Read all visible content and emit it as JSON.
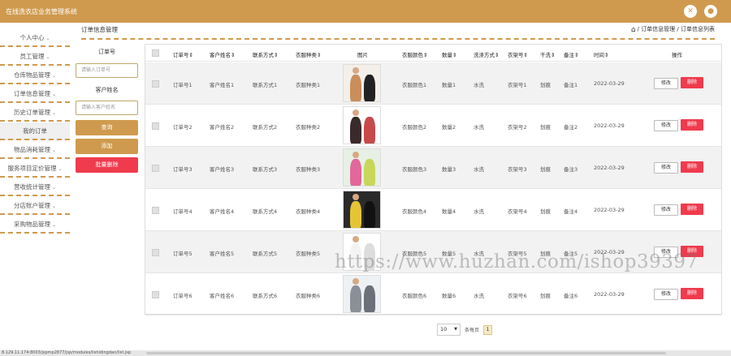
{
  "app": {
    "title": "在线洗衣店业务管理系统",
    "brand_color": "#cf9a4e"
  },
  "topbar": {
    "icons": [
      "expand-icon",
      "user-icon"
    ]
  },
  "sidebar": {
    "items": [
      {
        "label": "个人中心",
        "active": false
      },
      {
        "label": "员工管理",
        "active": false
      },
      {
        "label": "仓库物品管理",
        "active": false
      },
      {
        "label": "订单信息管理",
        "active": false
      },
      {
        "label": "历史订单管理",
        "active": false
      },
      {
        "label": "我的订单",
        "active": true
      },
      {
        "label": "物品消耗管理",
        "active": false
      },
      {
        "label": "服务项目定价管理",
        "active": false
      },
      {
        "label": "营收统计管理",
        "active": false
      },
      {
        "label": "分店账户管理",
        "active": false
      },
      {
        "label": "采购物品管理",
        "active": false
      }
    ]
  },
  "page": {
    "title": "订单信息管理",
    "breadcrumb": [
      "订单信息管理",
      "订单信息列表"
    ]
  },
  "search": {
    "order_no_label": "订单号",
    "order_no_placeholder": "请输入订单号",
    "customer_label": "客户姓名",
    "customer_placeholder": "请输入客户姓名",
    "query_button": "查询",
    "add_button": "添加",
    "batch_delete_button": "批量删除",
    "query_color": "#cf9a4e",
    "delete_color": "#ef3b4d"
  },
  "table": {
    "headers": [
      "订单号⇕",
      "客户姓名⇕",
      "联系方式⇕",
      "衣服种类⇕",
      "图片",
      "衣服颜色⇕",
      "数量⇕",
      "洗涤方式⇕",
      "衣架号⇕",
      "干洗⇕",
      "备注⇕",
      "时间⇕",
      "操作"
    ],
    "edit_label": "修改",
    "delete_label": "删除",
    "rows": [
      {
        "order_no": "订单号1",
        "customer": "客户姓名1",
        "contact": "联系方式1",
        "kind": "衣服种类1",
        "color": "衣服颜色1",
        "qty": "数量1",
        "wash": "水洗",
        "hanger": "衣架号1",
        "dry": "划痕",
        "note": "备注1",
        "date": "2022-03-29"
      },
      {
        "order_no": "订单号2",
        "customer": "客户姓名2",
        "contact": "联系方式2",
        "kind": "衣服种类2",
        "color": "衣服颜色2",
        "qty": "数量2",
        "wash": "水洗",
        "hanger": "衣架号2",
        "dry": "划痕",
        "note": "备注2",
        "date": "2022-03-29"
      },
      {
        "order_no": "订单号3",
        "customer": "客户姓名3",
        "contact": "联系方式3",
        "kind": "衣服种类3",
        "color": "衣服颜色3",
        "qty": "数量3",
        "wash": "水洗",
        "hanger": "衣架号3",
        "dry": "划痕",
        "note": "备注3",
        "date": "2022-03-29"
      },
      {
        "order_no": "订单号4",
        "customer": "客户姓名4",
        "contact": "联系方式4",
        "kind": "衣服种类4",
        "color": "衣服颜色4",
        "qty": "数量4",
        "wash": "水洗",
        "hanger": "衣架号4",
        "dry": "划痕",
        "note": "备注4",
        "date": "2022-03-29"
      },
      {
        "order_no": "订单号5",
        "customer": "客户姓名5",
        "contact": "联系方式5",
        "kind": "衣服种类5",
        "color": "衣服颜色5",
        "qty": "数量5",
        "wash": "水洗",
        "hanger": "衣架号5",
        "dry": "划痕",
        "note": "备注5",
        "date": "2022-03-29"
      },
      {
        "order_no": "订单号6",
        "customer": "客户姓名6",
        "contact": "联系方式6",
        "kind": "衣服种类6",
        "color": "衣服颜色6",
        "qty": "数量6",
        "wash": "水洗",
        "hanger": "衣架号6",
        "dry": "划痕",
        "note": "备注6",
        "date": "2022-03-29"
      }
    ]
  },
  "pager": {
    "page_size": "10",
    "suffix": "条每页",
    "current": "1"
  },
  "watermark": "https://www.huzhan.com/ishop39397",
  "status_url": "8.129.11.174:8003/jspmp2877/jsp/modules/lishidingdan/list.jsp"
}
